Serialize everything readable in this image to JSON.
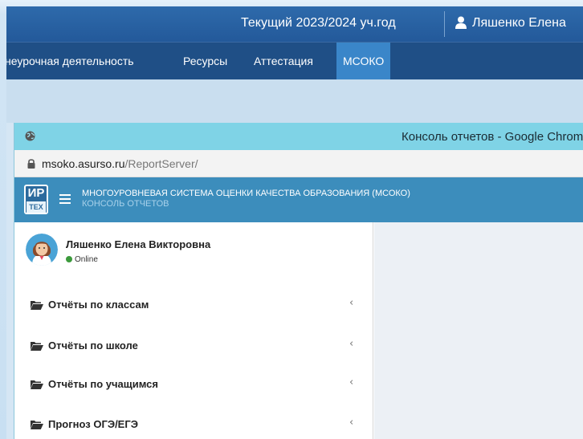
{
  "topbar": {
    "year": "Текущий 2023/2024 уч.год",
    "user": "Ляшенко Елена"
  },
  "nav": {
    "items": [
      "неурочная деятельность",
      "Ресурсы",
      "Аттестация",
      "МСОКО"
    ],
    "active": "МСОКО"
  },
  "popup": {
    "title": "Консоль отчетов - Google Chrome",
    "url_host": "msoko.asurso.ru",
    "url_path": "/ReportServer/"
  },
  "app": {
    "logo_top": "ИР",
    "logo_bottom": "ТЕХ",
    "title": "МНОГОУРОВНЕВАЯ СИСТЕМА ОЦЕНКИ КАЧЕСТВА ОБРАЗОВАНИЯ (МСОКО)",
    "subtitle": "КОНСОЛЬ ОТЧЕТОВ"
  },
  "sidebar": {
    "user_name": "Ляшенко Елена Викторовна",
    "status": "Online",
    "items": [
      {
        "label": "Отчёты по классам"
      },
      {
        "label": "Отчёты по школе"
      },
      {
        "label": "Отчёты по учащимся"
      },
      {
        "label": "Прогноз ОГЭ/ЕГЭ"
      }
    ],
    "chevron": "‹"
  },
  "colors": {
    "topbar": "#23599a",
    "navbar": "#1f4f86",
    "nav_active": "#3a86c9",
    "popup_title": "#7fd3e6",
    "app_header": "#3c8dbc",
    "online": "#3c9a3c"
  }
}
